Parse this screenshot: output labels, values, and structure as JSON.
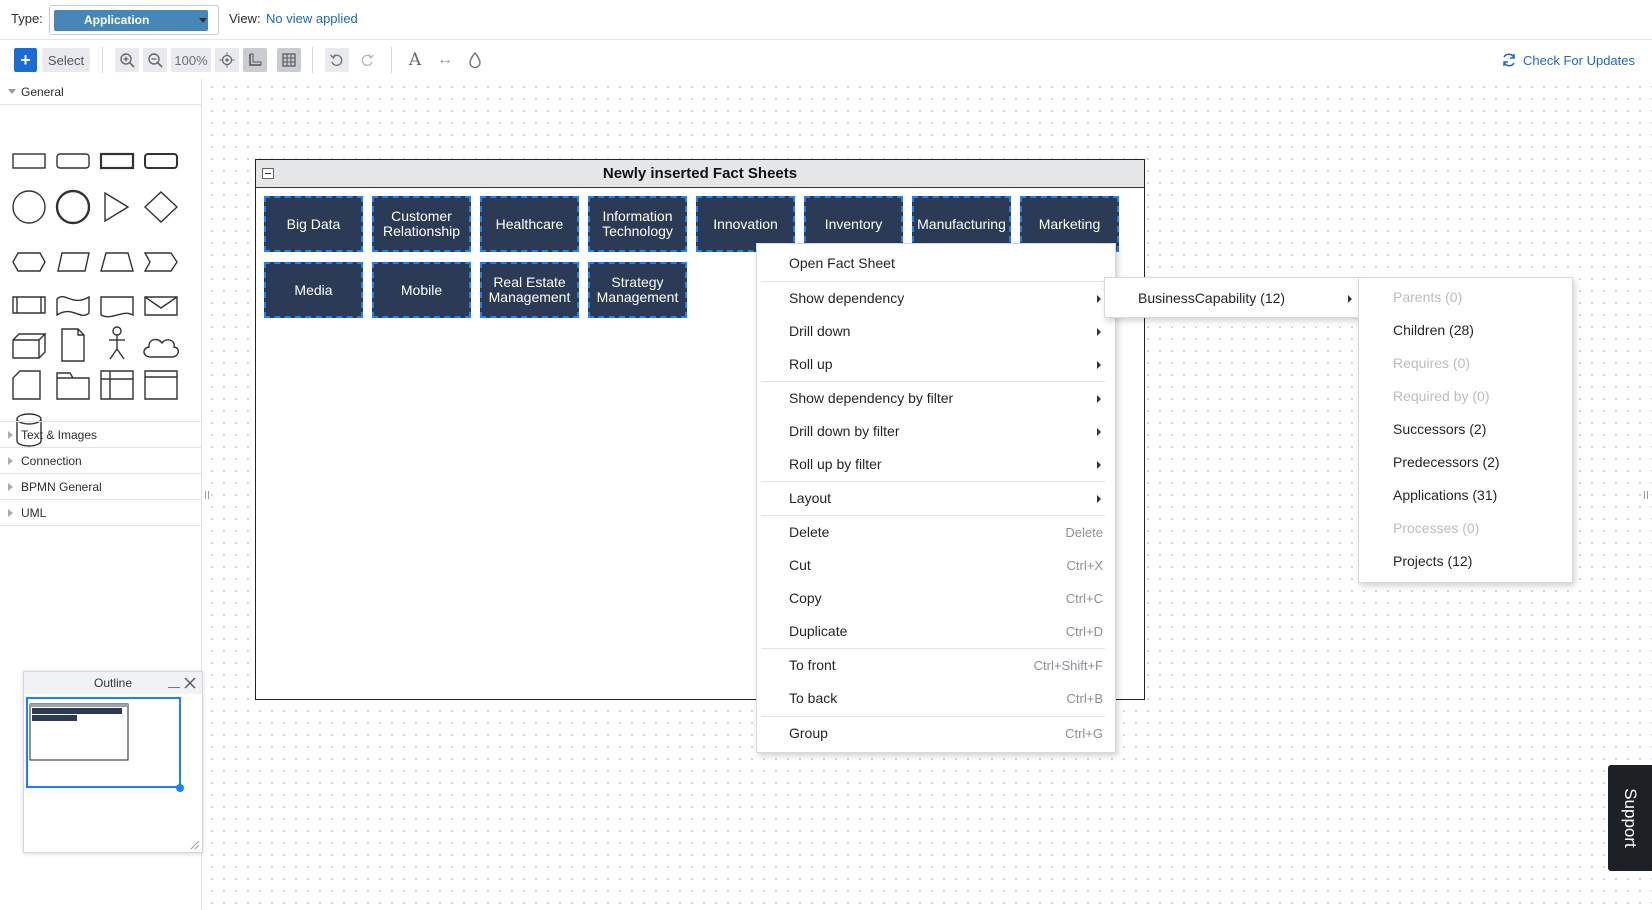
{
  "topbar": {
    "type_label": "Type:",
    "type_value": "Application",
    "view_label": "View:",
    "view_value": "No view applied"
  },
  "toolbar": {
    "add_label": "+",
    "select_label": "Select",
    "zoom_level": "100%",
    "check_updates_label": "Check For Updates",
    "accent_color": "#1b67c9"
  },
  "sidebar": {
    "general_label": "General",
    "sections": [
      "Text & Images",
      "Connection",
      "BPMN General",
      "UML"
    ]
  },
  "diagram": {
    "container_title": "Newly inserted Fact Sheets",
    "fact_sheets": [
      "Big Data",
      "Customer Relationship",
      "Healthcare",
      "Information Technology",
      "Innovation",
      "Inventory",
      "Manufacturing",
      "Marketing",
      "Media",
      "Mobile",
      "Real Estate Management",
      "Strategy Management"
    ],
    "node_color": "#2b3a55"
  },
  "context_menu": {
    "items": [
      {
        "label": "Open Fact Sheet",
        "shortcut": ""
      },
      {
        "label": "Show dependency",
        "shortcut": ""
      },
      {
        "label": "Drill down",
        "shortcut": ""
      },
      {
        "label": "Roll up",
        "shortcut": ""
      },
      {
        "label": "Show dependency by filter",
        "shortcut": ""
      },
      {
        "label": "Drill down by filter",
        "shortcut": ""
      },
      {
        "label": "Roll up by filter",
        "shortcut": ""
      },
      {
        "label": "Layout",
        "shortcut": ""
      },
      {
        "label": "Delete",
        "shortcut": "Delete"
      },
      {
        "label": "Cut",
        "shortcut": "Ctrl+X"
      },
      {
        "label": "Copy",
        "shortcut": "Ctrl+C"
      },
      {
        "label": "Duplicate",
        "shortcut": "Ctrl+D"
      },
      {
        "label": "To front",
        "shortcut": "Ctrl+Shift+F"
      },
      {
        "label": "To back",
        "shortcut": "Ctrl+B"
      },
      {
        "label": "Group",
        "shortcut": "Ctrl+G"
      }
    ]
  },
  "submenu1": {
    "items": [
      {
        "label": "BusinessCapability (12)"
      }
    ]
  },
  "submenu2": {
    "items": [
      {
        "label": "Parents (0)",
        "disabled": true
      },
      {
        "label": "Children (28)",
        "disabled": false
      },
      {
        "label": "Requires (0)",
        "disabled": true
      },
      {
        "label": "Required by (0)",
        "disabled": true
      },
      {
        "label": "Successors (2)",
        "disabled": false
      },
      {
        "label": "Predecessors (2)",
        "disabled": false
      },
      {
        "label": "Applications (31)",
        "disabled": false
      },
      {
        "label": "Processes (0)",
        "disabled": true
      },
      {
        "label": "Projects (12)",
        "disabled": false
      }
    ]
  },
  "outline_panel": {
    "title": "Outline"
  },
  "support": {
    "label": "Support"
  }
}
